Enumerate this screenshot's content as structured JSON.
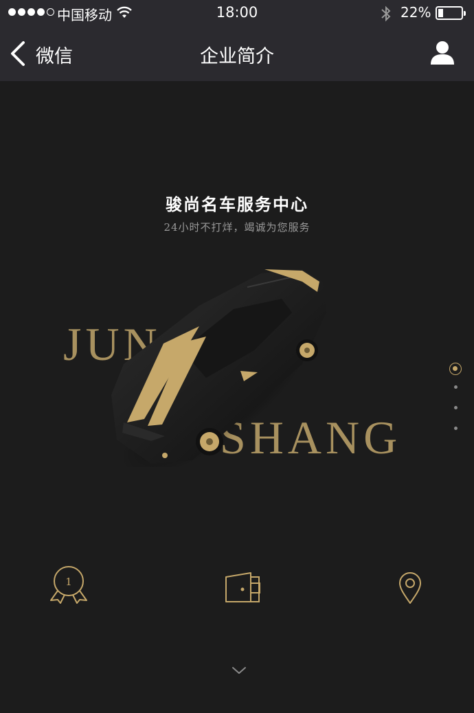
{
  "status_bar": {
    "carrier": "中国移动",
    "time": "18:00",
    "battery_percent": "22%",
    "battery_level": 0.22,
    "signal_bars_filled": 4,
    "signal_bars_total": 5,
    "icons": [
      "signal-dots-icon",
      "wifi-icon",
      "bluetooth-icon",
      "battery-icon"
    ]
  },
  "nav_bar": {
    "back_label": "微信",
    "title": "企业简介",
    "icons": [
      "chevron-left-icon",
      "user-profile-icon"
    ]
  },
  "hero": {
    "title": "骏尚名车服务中心",
    "subtitle": "24小时不打烊，竭诚为您服务",
    "brand_word_1": "JUN",
    "brand_word_2": "SHANG",
    "image": "black-gold-sports-car"
  },
  "pager": {
    "total": 4,
    "active_index": 0
  },
  "features": [
    {
      "icon": "award-medal-icon",
      "badge_text": "1"
    },
    {
      "icon": "wallet-icon"
    },
    {
      "icon": "location-pin-icon"
    }
  ],
  "footer": {
    "icon": "chevron-down-icon"
  },
  "colors": {
    "background": "#1c1c1c",
    "bar_background": "#2b2a2f",
    "gold_accent": "#c6a86a",
    "brand_text": "#a8915f",
    "subtitle_gray": "#9a9a9a"
  }
}
